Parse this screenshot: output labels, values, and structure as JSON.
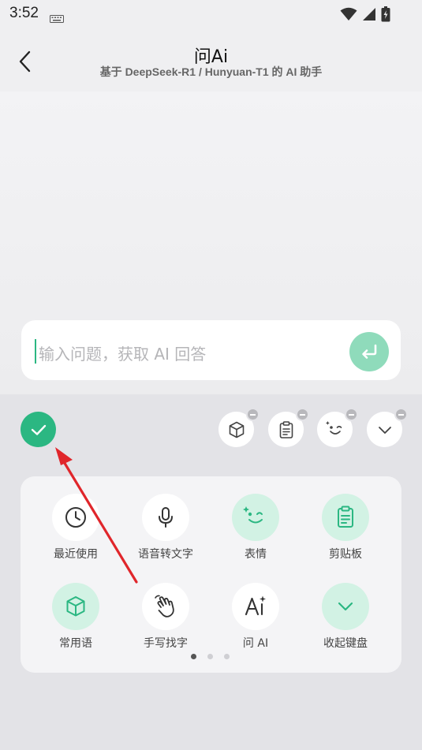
{
  "status_bar": {
    "time": "3:52"
  },
  "header": {
    "title": "问Ai",
    "subtitle": "基于 DeepSeek-R1 / Hunyuan-T1 的 AI 助手"
  },
  "input": {
    "placeholder": "输入问题，获取 AI 回答"
  },
  "quick_icons": [
    {
      "icon": "cube-icon"
    },
    {
      "icon": "clipboard-icon"
    },
    {
      "icon": "emoji-icon"
    },
    {
      "icon": "chevron-down-icon"
    }
  ],
  "tools": [
    {
      "label": "最近使用",
      "icon": "clock-icon"
    },
    {
      "label": "语音转文字",
      "icon": "microphone-icon"
    },
    {
      "label": "表情",
      "icon": "emoji-icon"
    },
    {
      "label": "剪贴板",
      "icon": "clipboard-icon"
    },
    {
      "label": "常用语",
      "icon": "cube-icon"
    },
    {
      "label": "手写找字",
      "icon": "hand-icon"
    },
    {
      "label": "问 AI",
      "icon": "ai-icon"
    },
    {
      "label": "收起键盘",
      "icon": "chevron-down-icon"
    }
  ],
  "pager": {
    "current_page": 1,
    "total_pages": 3
  },
  "colors": {
    "accent": "#2bb782",
    "accent_light": "#d2f2e4",
    "annotation_arrow": "#e0262b"
  }
}
